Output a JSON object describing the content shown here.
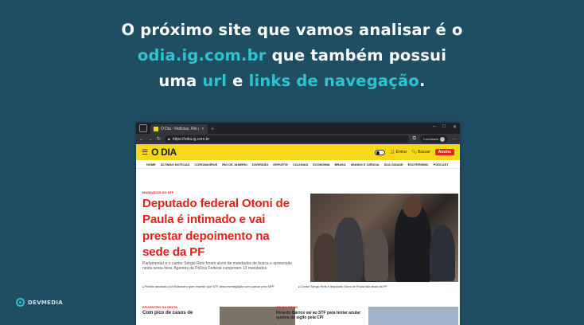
{
  "heading": {
    "line1": "O próximo site que vamos analisar é o",
    "line2_highlight": "odia.ig.com.br",
    "line2_rest": " que também possui",
    "line3_a": "uma ",
    "line3_url": "url",
    "line3_b": " e ",
    "line3_links": "links de navegação",
    "line3_end": "."
  },
  "brand": {
    "name": "DEVMEDIA"
  },
  "browser": {
    "tab_title": "O Dia - Notícias, Rio de Janeiro",
    "url": "https://odia.ig.com.br",
    "profile": "Convidado"
  },
  "site": {
    "logo": "O DIA",
    "login": "Entrar",
    "search": "Buscar",
    "subscribe": "Assine",
    "nav": [
      "HOME",
      "ÚLTIMAS NOTÍCIAS",
      "CORONAVÍRUS",
      "RIO DE JANEIRO",
      "DIVERSÃO",
      "ESPORTE",
      "COLUNAS",
      "ECONOMIA",
      "BRASIL",
      "MUNDO E CIÊNCIA",
      "SUA CIDADE",
      "ESOTERISMO",
      "PODCAST"
    ],
    "main": {
      "kicker": "MANDADOS DO STF",
      "headline": "Deputado federal Otoni de Paula é intimado e vai prestar depoimento na sede da PF",
      "summary": "Parlamentar e o cantor Sérgio Reis foram alvos de mandados de busca e apreensão nesta sexta-feira. Agentes da Polícia Federal cumpriram 13 mandados",
      "bullet_left": "Pedido assinado por Bolsonaro quer impedir que STF abra investigação com passar pelo MPF",
      "bullet_right": "Cantor Sérgio Reis e deputado Otoni de Paula são alvos da PF"
    },
    "bottom_left": {
      "kicker": "EPICENTRO DA DELTA",
      "headline": "Com pico de casos de"
    },
    "bottom_right": {
      "kicker": "CPI DA COVID",
      "headline": "Ricardo Barros vai ao STF para tentar anular quebra de sigilo pela CPI"
    }
  }
}
